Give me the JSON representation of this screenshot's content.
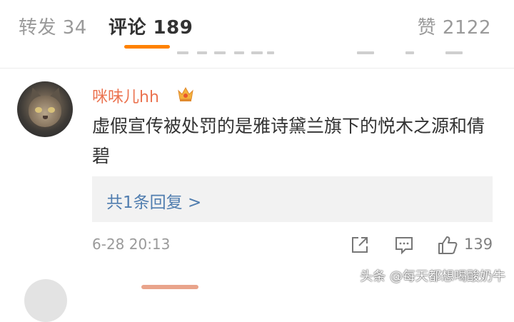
{
  "tabs": {
    "repost": "转发 34",
    "comments": "评论 189",
    "likes": "赞 2122",
    "active_color": "#ff8200"
  },
  "comment": {
    "username": "咪味儿hh",
    "badge_icon": "crown-badge-icon",
    "text": "虚假宣传被处罚的是雅诗黛兰旗下的悦木之源和倩碧",
    "replies_label": "共1条回复 >",
    "timestamp": "6-28 20:13",
    "like_count": "139",
    "username_color": "#eb7350",
    "link_color": "#507daf"
  },
  "watermark": "头条 @每天都想喝酸奶牛"
}
